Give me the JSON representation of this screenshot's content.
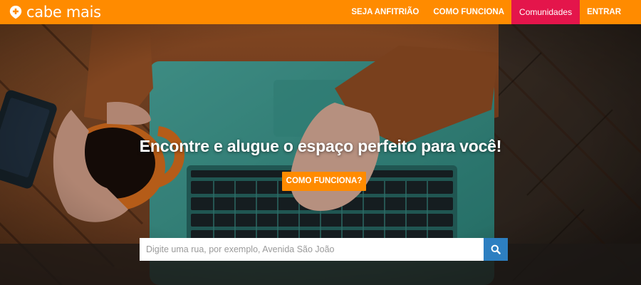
{
  "brand": {
    "name": "cabe mais"
  },
  "nav": {
    "items": [
      {
        "label": "SEJA ANFITRIÃO"
      },
      {
        "label": "COMO FUNCIONA"
      },
      {
        "label": "Comunidades",
        "active": true
      },
      {
        "label": "ENTRAR"
      }
    ]
  },
  "hero": {
    "headline": "Encontre e alugue o espaço perfeito para você!",
    "cta_label": "COMO FUNCIONA?"
  },
  "search": {
    "placeholder": "Digite uma rua, por exemplo, Avenida São João",
    "value": ""
  },
  "icons": {
    "logo": "location-pin-plus-icon",
    "search_button": "search-icon"
  },
  "colors": {
    "brand_orange": "#ff8b00",
    "active_nav": "#e4154b",
    "search_button": "#2d7fc1"
  }
}
